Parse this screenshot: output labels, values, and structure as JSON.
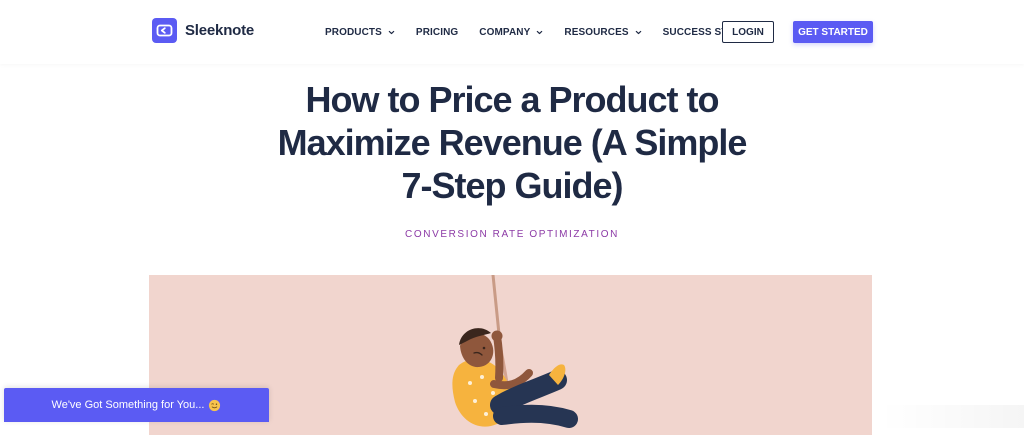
{
  "brand": {
    "name": "Sleeknote",
    "color": "#5b5bf3"
  },
  "nav": {
    "items": [
      {
        "label": "PRODUCTS",
        "icon": "chevron-down-icon"
      },
      {
        "label": "PRICING"
      },
      {
        "label": "COMPANY",
        "icon": "chevron-down-icon"
      },
      {
        "label": "RESOURCES",
        "icon": "chevron-down-icon"
      },
      {
        "label": "SUCCESS STORIES"
      }
    ],
    "login_label": "LOGIN",
    "cta_label": "GET STARTED"
  },
  "article": {
    "title": "How to Price a Product to Maximize Revenue (A Simple 7-Step Guide)",
    "category": "CONVERSION RATE OPTIMIZATION",
    "hero_background": "#f1d5ce"
  },
  "promo": {
    "label": "We've Got Something for You...",
    "icon": "winking-face-icon"
  },
  "colors": {
    "text": "#1f2a44",
    "category": "#8c3aa6"
  }
}
